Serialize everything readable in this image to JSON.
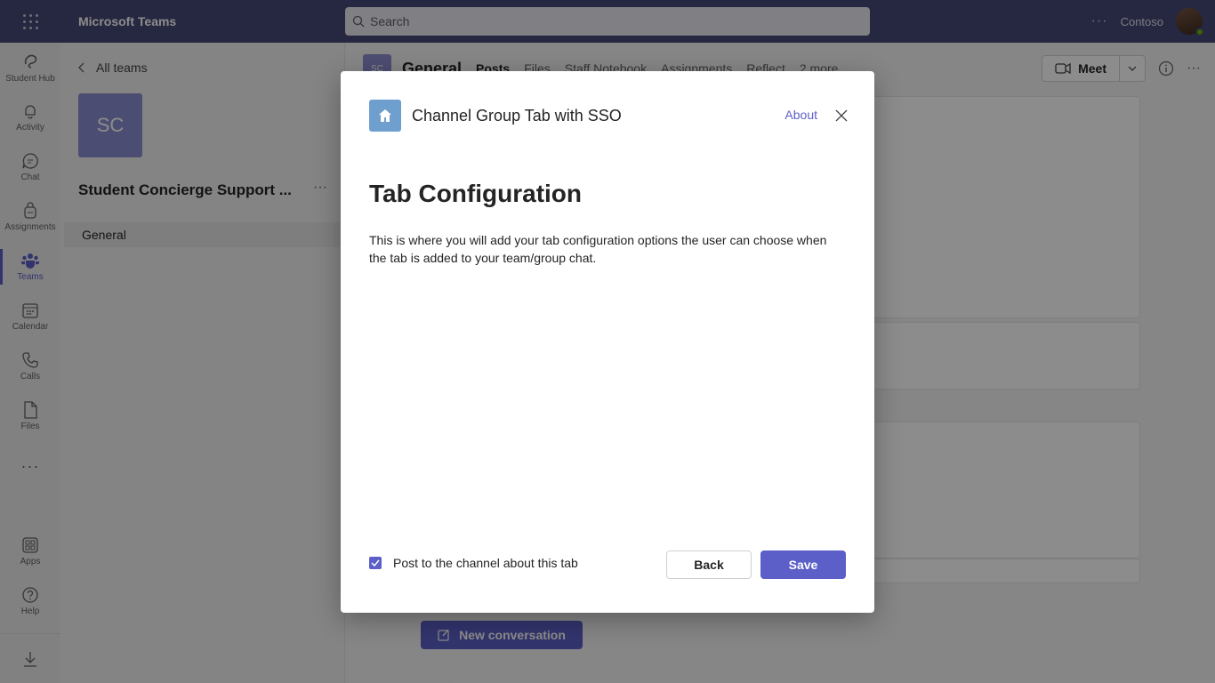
{
  "topbar": {
    "app_title": "Microsoft Teams",
    "search_placeholder": "Search",
    "org_name": "Contoso",
    "more_label": "···"
  },
  "rail": {
    "items": [
      {
        "label": "Student Hub",
        "icon": "student-hub-icon"
      },
      {
        "label": "Activity",
        "icon": "bell-icon"
      },
      {
        "label": "Chat",
        "icon": "chat-icon"
      },
      {
        "label": "Assignments",
        "icon": "backpack-icon"
      },
      {
        "label": "Teams",
        "icon": "teams-icon",
        "active": true
      },
      {
        "label": "Calendar",
        "icon": "calendar-icon"
      },
      {
        "label": "Calls",
        "icon": "phone-icon"
      },
      {
        "label": "Files",
        "icon": "file-icon"
      },
      {
        "label": "Apps",
        "icon": "apps-icon"
      },
      {
        "label": "Help",
        "icon": "help-icon"
      }
    ],
    "more_label": "···"
  },
  "team_panel": {
    "back_label": "All teams",
    "team_initials": "SC",
    "team_name": "Student Concierge Support ...",
    "more_label": "···",
    "channels": [
      {
        "label": "General"
      }
    ]
  },
  "channel": {
    "initials": "SC",
    "title": "General",
    "tabs": [
      "Posts",
      "Files",
      "Staff Notebook",
      "Assignments",
      "Reflect",
      "2 more"
    ],
    "meet_label": "Meet",
    "new_conversation_label": "New conversation"
  },
  "dialog": {
    "app_name": "Channel Group Tab with SSO",
    "about_label": "About",
    "heading": "Tab Configuration",
    "body": "This is where you will add your tab configuration options the user can choose when the tab is added to your team/group chat.",
    "checkbox_label": "Post to the channel about this tab",
    "checkbox_checked": true,
    "back_label": "Back",
    "save_label": "Save"
  },
  "colors": {
    "brand": "#5b5fc7",
    "topbar": "#464775",
    "app_icon": "#6f9fcf"
  }
}
